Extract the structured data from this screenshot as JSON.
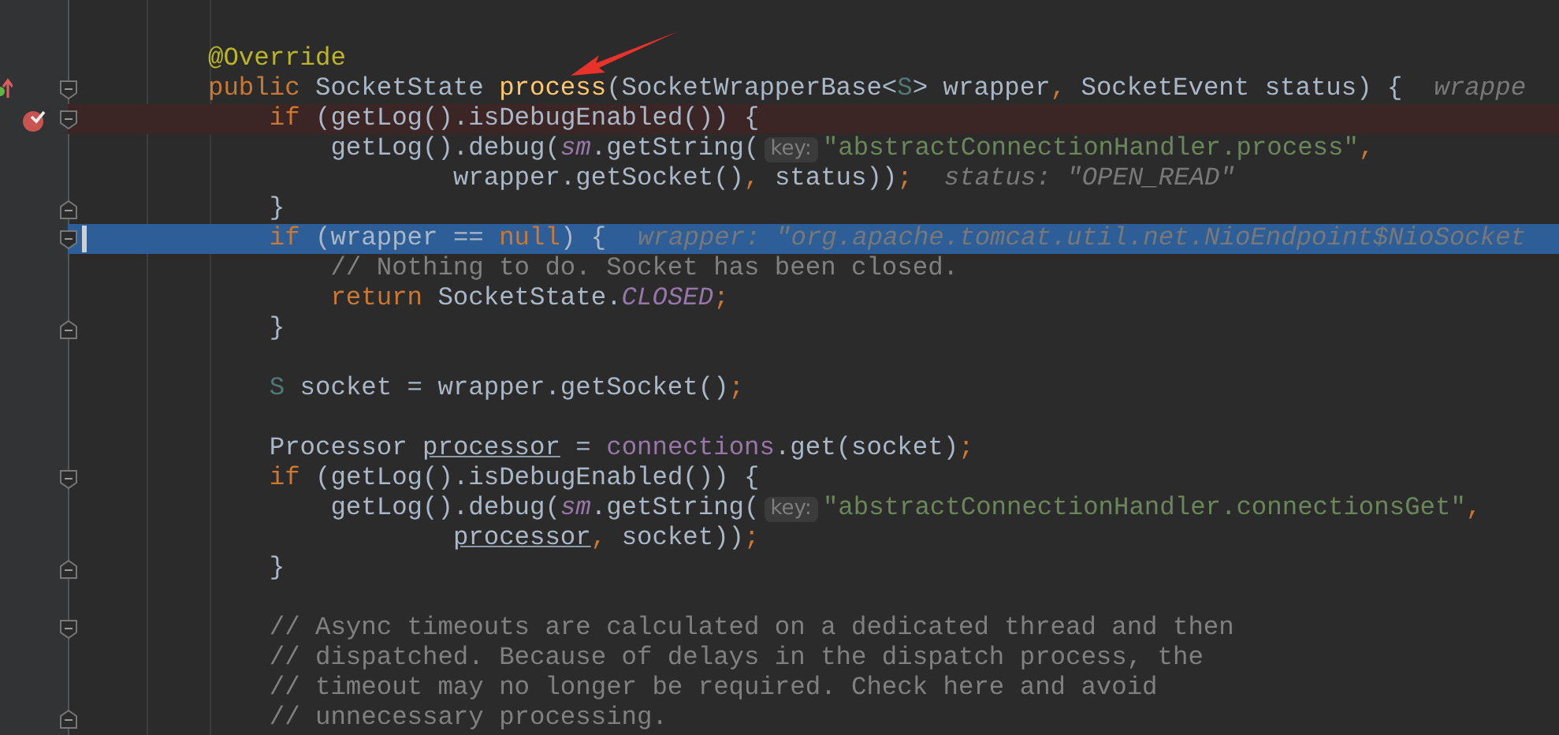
{
  "editor": {
    "lines": [
      {
        "fold_start": false,
        "fold_end": false,
        "breakpoint": false,
        "execution": false
      },
      {
        "fold_start": false,
        "fold_end": false,
        "breakpoint": false,
        "execution": false,
        "tokens": [
          {
            "kind": "ann",
            "text": "@Override"
          }
        ]
      },
      {
        "fold_start": true,
        "fold_end": false,
        "breakpoint": false,
        "execution": false,
        "override": true,
        "tokens": [
          {
            "kind": "kw",
            "text": "public "
          },
          {
            "kind": "plain",
            "text": "SocketState "
          },
          {
            "kind": "decl",
            "text": "process"
          },
          {
            "kind": "plain",
            "text": "(SocketWrapperBase<"
          },
          {
            "kind": "tparam",
            "text": "S"
          },
          {
            "kind": "plain",
            "text": "> wrapper"
          },
          {
            "kind": "punct",
            "text": ", "
          },
          {
            "kind": "plain",
            "text": "SocketEvent status) {"
          },
          {
            "kind": "dbg",
            "text": "wrappe"
          }
        ]
      },
      {
        "fold_start": true,
        "fold_end": false,
        "breakpoint": true,
        "execution": false,
        "tokens": [
          {
            "kind": "kw",
            "text": "    if "
          },
          {
            "kind": "plain",
            "text": "(getLog().isDebugEnabled()) {"
          }
        ]
      },
      {
        "fold_start": false,
        "fold_end": false,
        "breakpoint": false,
        "execution": false,
        "tokens": [
          {
            "kind": "plain",
            "text": "        getLog().debug("
          },
          {
            "kind": "static",
            "text": "sm"
          },
          {
            "kind": "plain",
            "text": ".getString("
          },
          {
            "kind": "hint",
            "text": "key:"
          },
          {
            "kind": "str",
            "text": "\"abstractConnectionHandler.process\""
          },
          {
            "kind": "punct",
            "text": ","
          }
        ]
      },
      {
        "fold_start": false,
        "fold_end": false,
        "breakpoint": false,
        "execution": false,
        "tokens": [
          {
            "kind": "plain",
            "text": "                wrapper.getSocket()"
          },
          {
            "kind": "punct",
            "text": ", "
          },
          {
            "kind": "plain",
            "text": "status))"
          },
          {
            "kind": "punct",
            "text": ";"
          },
          {
            "kind": "dbg",
            "text": "status: \"OPEN_READ\""
          }
        ]
      },
      {
        "fold_start": false,
        "fold_end": true,
        "breakpoint": false,
        "execution": false,
        "tokens": [
          {
            "kind": "plain",
            "text": "    }"
          }
        ]
      },
      {
        "fold_start": true,
        "fold_end": false,
        "breakpoint": false,
        "execution": true,
        "tokens": [
          {
            "kind": "kw",
            "text": "    if "
          },
          {
            "kind": "plain",
            "text": "(wrapper == "
          },
          {
            "kind": "kw",
            "text": "null"
          },
          {
            "kind": "plain",
            "text": ") {"
          },
          {
            "kind": "dbg",
            "text": "wrapper: \"org.apache.tomcat.util.net.NioEndpoint$NioSocket"
          }
        ]
      },
      {
        "fold_start": false,
        "fold_end": false,
        "breakpoint": false,
        "execution": false,
        "tokens": [
          {
            "kind": "comment",
            "text": "        // Nothing to do. Socket has been closed."
          }
        ]
      },
      {
        "fold_start": false,
        "fold_end": false,
        "breakpoint": false,
        "execution": false,
        "tokens": [
          {
            "kind": "kw",
            "text": "        return "
          },
          {
            "kind": "plain",
            "text": "SocketState."
          },
          {
            "kind": "static",
            "text": "CLOSED"
          },
          {
            "kind": "punct",
            "text": ";"
          }
        ]
      },
      {
        "fold_start": false,
        "fold_end": true,
        "breakpoint": false,
        "execution": false,
        "tokens": [
          {
            "kind": "plain",
            "text": "    }"
          }
        ]
      },
      {
        "fold_start": false,
        "fold_end": false,
        "breakpoint": false,
        "execution": false
      },
      {
        "fold_start": false,
        "fold_end": false,
        "breakpoint": false,
        "execution": false,
        "tokens": [
          {
            "kind": "tparam",
            "text": "    S "
          },
          {
            "kind": "plain",
            "text": "socket = wrapper.getSocket()"
          },
          {
            "kind": "punct",
            "text": ";"
          }
        ]
      },
      {
        "fold_start": false,
        "fold_end": false,
        "breakpoint": false,
        "execution": false
      },
      {
        "fold_start": false,
        "fold_end": false,
        "breakpoint": false,
        "execution": false,
        "tokens": [
          {
            "kind": "plain",
            "text": "    Processor "
          },
          {
            "kind": "ref",
            "text": "processor"
          },
          {
            "kind": "plain",
            "text": " = "
          },
          {
            "kind": "field",
            "text": "connections"
          },
          {
            "kind": "plain",
            "text": ".get(socket)"
          },
          {
            "kind": "punct",
            "text": ";"
          }
        ]
      },
      {
        "fold_start": true,
        "fold_end": false,
        "breakpoint": false,
        "execution": false,
        "tokens": [
          {
            "kind": "kw",
            "text": "    if "
          },
          {
            "kind": "plain",
            "text": "(getLog().isDebugEnabled()) {"
          }
        ]
      },
      {
        "fold_start": false,
        "fold_end": false,
        "breakpoint": false,
        "execution": false,
        "tokens": [
          {
            "kind": "plain",
            "text": "        getLog().debug("
          },
          {
            "kind": "static",
            "text": "sm"
          },
          {
            "kind": "plain",
            "text": ".getString("
          },
          {
            "kind": "hint",
            "text": "key:"
          },
          {
            "kind": "str",
            "text": "\"abstractConnectionHandler.connectionsGet\""
          },
          {
            "kind": "punct",
            "text": ","
          }
        ]
      },
      {
        "fold_start": false,
        "fold_end": false,
        "breakpoint": false,
        "execution": false,
        "tokens": [
          {
            "kind": "ref",
            "text": "                processor"
          },
          {
            "kind": "punct",
            "text": ", "
          },
          {
            "kind": "plain",
            "text": "socket))"
          },
          {
            "kind": "punct",
            "text": ";"
          }
        ]
      },
      {
        "fold_start": false,
        "fold_end": true,
        "breakpoint": false,
        "execution": false,
        "tokens": [
          {
            "kind": "plain",
            "text": "    }"
          }
        ]
      },
      {
        "fold_start": false,
        "fold_end": false,
        "breakpoint": false,
        "execution": false
      },
      {
        "fold_start": true,
        "fold_end": false,
        "breakpoint": false,
        "execution": false,
        "tokens": [
          {
            "kind": "comment",
            "text": "    // Async timeouts are calculated on a dedicated thread and then"
          }
        ]
      },
      {
        "fold_start": false,
        "fold_end": false,
        "breakpoint": false,
        "execution": false,
        "tokens": [
          {
            "kind": "comment",
            "text": "    // dispatched. Because of delays in the dispatch process, the"
          }
        ]
      },
      {
        "fold_start": false,
        "fold_end": false,
        "breakpoint": false,
        "execution": false,
        "tokens": [
          {
            "kind": "comment",
            "text": "    // timeout may no longer be required. Check here and avoid"
          }
        ]
      },
      {
        "fold_start": false,
        "fold_end": true,
        "breakpoint": false,
        "execution": false,
        "tokens": [
          {
            "kind": "comment",
            "text": "    // unnecessary processing."
          }
        ]
      }
    ]
  }
}
